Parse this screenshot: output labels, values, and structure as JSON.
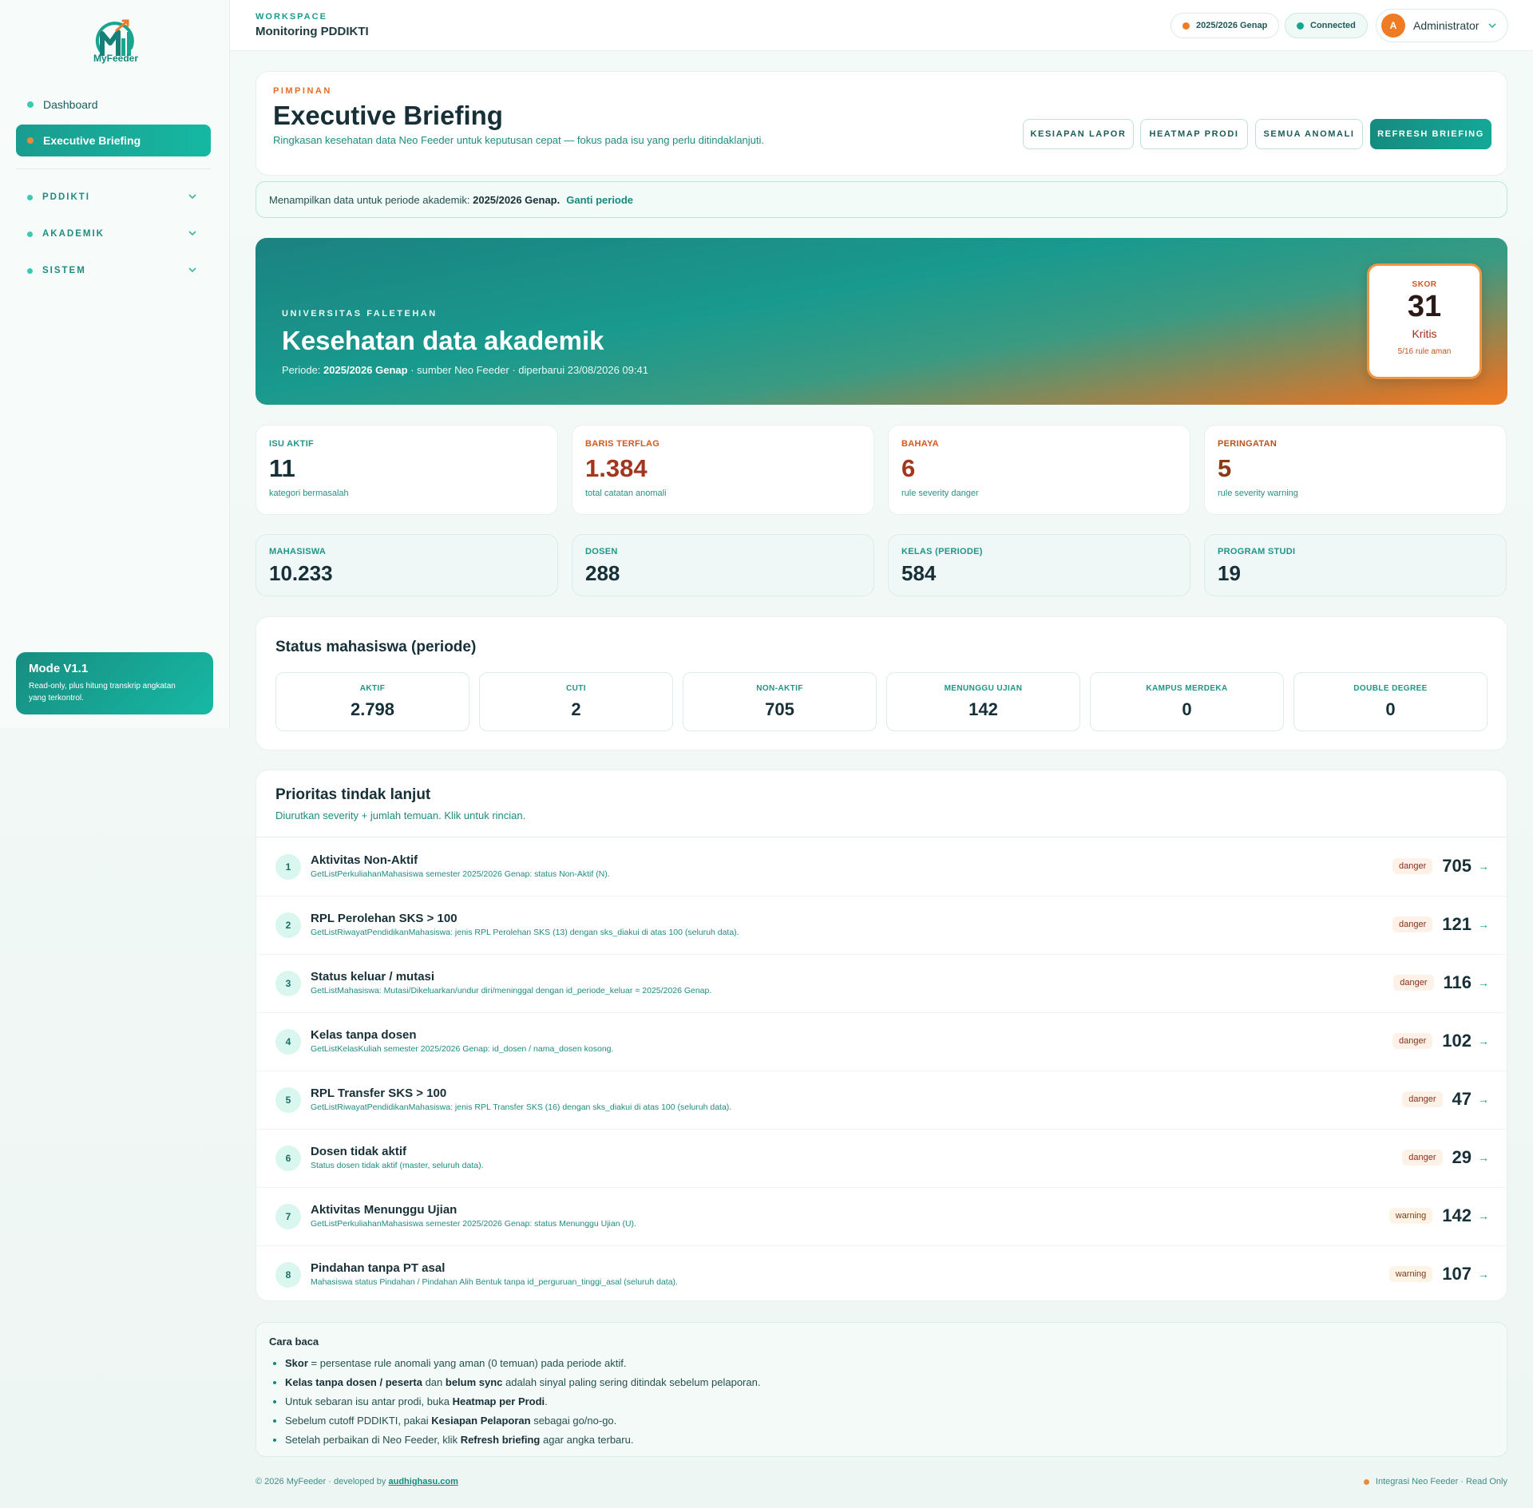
{
  "brand": {
    "logo_text": "MyFeeder"
  },
  "sidebar": {
    "items": [
      {
        "label": "Dashboard"
      },
      {
        "label": "Executive Briefing"
      }
    ],
    "groups": [
      {
        "label": "PDDIKTI"
      },
      {
        "label": "AKADEMIK"
      },
      {
        "label": "SISTEM"
      }
    ],
    "mode": {
      "title": "Mode V1.1",
      "desc": "Read-only, plus hitung transkrip angkatan yang terkontrol."
    }
  },
  "topbar": {
    "workspace_label": "WORKSPACE",
    "workspace_title": "Monitoring PDDIKTI",
    "period": "2025/2026 Genap",
    "connection": "Connected",
    "user_initial": "A",
    "user": "Administrator"
  },
  "header": {
    "kicker": "PIMPINAN",
    "title": "Executive Briefing",
    "subtitle": "Ringkasan kesehatan data Neo Feeder untuk keputusan cepat — fokus pada isu yang perlu ditindaklanjuti.",
    "buttons": {
      "readiness": "KESIAPAN LAPOR",
      "heatmap": "HEATMAP PRODI",
      "anomalies": "SEMUA ANOMALI",
      "refresh": "REFRESH BRIEFING"
    }
  },
  "period_bar": {
    "prefix": "Menampilkan data untuk periode akademik:",
    "period": "2025/2026 Genap.",
    "link": "Ganti periode"
  },
  "hero": {
    "institution": "UNIVERSITAS FALETEHAN",
    "title": "Kesehatan data akademik",
    "meta_prefix": "Periode:",
    "meta_period": "2025/2026 Genap",
    "meta_suffix": "· sumber Neo Feeder · diperbarui 23/08/2026 09:41",
    "score": {
      "label": "SKOR",
      "value": "31",
      "status": "Kritis",
      "detail": "5/16 rule aman"
    }
  },
  "stats": [
    {
      "label": "ISU AKTIF",
      "value": "11",
      "desc": "kategori bermasalah",
      "color": "#1f9587",
      "value_color": "#173037"
    },
    {
      "label": "BARIS TERFLAG",
      "value": "1.384",
      "desc": "total catatan anomali",
      "color": "#d4571e",
      "value_color": "#a3361e"
    },
    {
      "label": "BAHAYA",
      "value": "6",
      "desc": "rule severity danger",
      "color": "#d4571e",
      "value_color": "#a3361e"
    },
    {
      "label": "PERINGATAN",
      "value": "5",
      "desc": "rule severity warning",
      "color": "#b8531b",
      "value_color": "#8a3a17"
    }
  ],
  "totals": [
    {
      "label": "MAHASISWA",
      "value": "10.233"
    },
    {
      "label": "DOSEN",
      "value": "288"
    },
    {
      "label": "KELAS (PERIODE)",
      "value": "584"
    },
    {
      "label": "PROGRAM STUDI",
      "value": "19"
    }
  ],
  "status_mahasiswa": {
    "title": "Status mahasiswa (periode)",
    "items": [
      {
        "label": "AKTIF",
        "value": "2.798"
      },
      {
        "label": "CUTI",
        "value": "2"
      },
      {
        "label": "NON-AKTIF",
        "value": "705"
      },
      {
        "label": "MENUNGGU UJIAN",
        "value": "142"
      },
      {
        "label": "KAMPUS MERDEKA",
        "value": "0"
      },
      {
        "label": "DOUBLE DEGREE",
        "value": "0"
      }
    ]
  },
  "priorities": {
    "title": "Prioritas tindak lanjut",
    "subtitle": "Diurutkan severity + jumlah temuan. Klik untuk rincian.",
    "arrow": "→",
    "rows": [
      {
        "num": "1",
        "title": "Aktivitas Non-Aktif",
        "desc": "GetListPerkuliahanMahasiswa semester 2025/2026 Genap: status Non-Aktif (N).",
        "severity": "danger",
        "value": "705"
      },
      {
        "num": "2",
        "title": "RPL Perolehan SKS > 100",
        "desc": "GetListRiwayatPendidikanMahasiswa: jenis RPL Perolehan SKS (13) dengan sks_diakui di atas 100 (seluruh data).",
        "severity": "danger",
        "value": "121"
      },
      {
        "num": "3",
        "title": "Status keluar / mutasi",
        "desc": "GetListMahasiswa: Mutasi/Dikeluarkan/undur diri/meninggal dengan id_periode_keluar = 2025/2026 Genap.",
        "severity": "danger",
        "value": "116"
      },
      {
        "num": "4",
        "title": "Kelas tanpa dosen",
        "desc": "GetListKelasKuliah semester 2025/2026 Genap: id_dosen / nama_dosen kosong.",
        "severity": "danger",
        "value": "102"
      },
      {
        "num": "5",
        "title": "RPL Transfer SKS > 100",
        "desc": "GetListRiwayatPendidikanMahasiswa: jenis RPL Transfer SKS (16) dengan sks_diakui di atas 100 (seluruh data).",
        "severity": "danger",
        "value": "47"
      },
      {
        "num": "6",
        "title": "Dosen tidak aktif",
        "desc": "Status dosen tidak aktif (master, seluruh data).",
        "severity": "danger",
        "value": "29"
      },
      {
        "num": "7",
        "title": "Aktivitas Menunggu Ujian",
        "desc": "GetListPerkuliahanMahasiswa semester 2025/2026 Genap: status Menunggu Ujian (U).",
        "severity": "warning",
        "value": "142"
      },
      {
        "num": "8",
        "title": "Pindahan tanpa PT asal",
        "desc": "Mahasiswa status Pindahan / Pindahan Alih Bentuk tanpa id_perguruan_tinggi_asal (seluruh data).",
        "severity": "warning",
        "value": "107"
      }
    ]
  },
  "cara_baca": {
    "title": "Cara baca",
    "l1_b": "Skor",
    "l1": " = persentase rule anomali yang aman (0 temuan) pada periode aktif.",
    "l2_b1": "Kelas tanpa dosen / peserta",
    "l2_m": " dan ",
    "l2_b2": "belum sync",
    "l2": " adalah sinyal paling sering ditindak sebelum pelaporan.",
    "l3": "Untuk sebaran isu antar prodi, buka ",
    "l3_b": "Heatmap per Prodi",
    "l3_e": ".",
    "l4": "Sebelum cutoff PDDIKTI, pakai ",
    "l4_b": "Kesiapan Pelaporan",
    "l4_e": " sebagai go/no-go.",
    "l5": "Setelah perbaikan di Neo Feeder, klik ",
    "l5_b": "Refresh briefing",
    "l5_e": " agar angka terbaru."
  },
  "footer": {
    "left": "© 2026 MyFeeder · developed by ",
    "link": "audhighasu.com",
    "right": "Integrasi Neo Feeder · Read Only"
  },
  "colors": {
    "accent": "#16897d",
    "orange": "#f07b25",
    "connected": "#17a58f"
  },
  "icons": {
    "logo": "myfeeder-logo-icon",
    "chevron": "chevron-down-icon",
    "arrow": "arrow-right-icon"
  }
}
